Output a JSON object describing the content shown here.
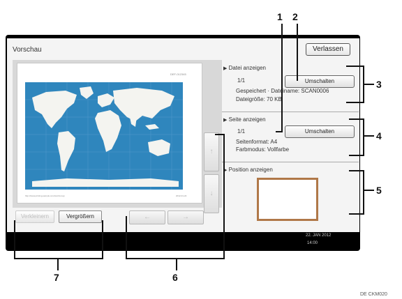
{
  "screen": {
    "title": "Vorschau",
    "exit_label": "Verlassen"
  },
  "preview": {
    "page_header": "DEF-012345",
    "footer_left": "http://www.printing-sample.com/world-map",
    "footer_right": "2012-01-22",
    "zoom_out_label": "Verkleinern",
    "zoom_in_label": "Vergrößern",
    "scroll_up_icon": "↑",
    "scroll_down_icon": "↓",
    "scroll_left_icon": "←",
    "scroll_right_icon": "→"
  },
  "file_section": {
    "heading": "Datei anzeigen",
    "page_counter": "1/1",
    "switch_label": "Umschalten",
    "saved_info": "Gespeichert · Dateiname: SCAN0006",
    "size_info": "Dateigröße: 70 KB"
  },
  "page_section": {
    "heading": "Seite anzeigen",
    "page_counter": "1/1",
    "switch_label": "Umschalten",
    "page_format": "Seitenformat: A4",
    "color_mode": "Farbmodus: Vollfarbe"
  },
  "position_section": {
    "heading": "Position anzeigen"
  },
  "status_bar": {
    "date": "22. JAN   2012",
    "time": "14:00"
  },
  "callouts": {
    "c1": "1",
    "c2": "2",
    "c3": "3",
    "c4": "4",
    "c5": "5",
    "c6": "6",
    "c7": "7"
  },
  "doc_code": "DE CKM020",
  "icons": {
    "section_marker": "▶"
  }
}
